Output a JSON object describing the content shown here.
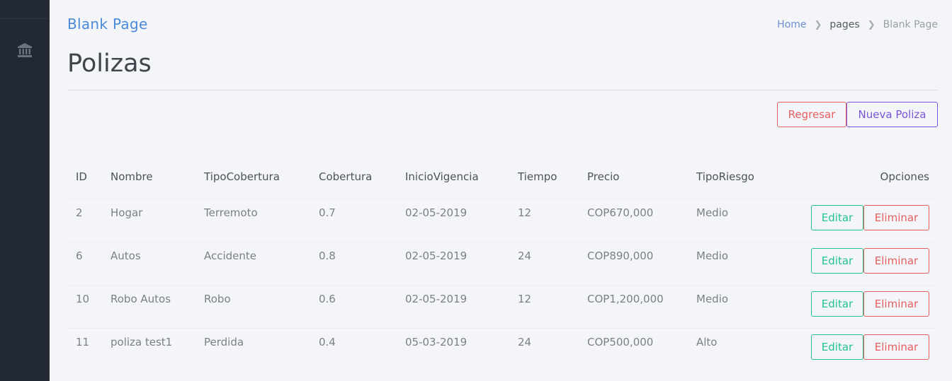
{
  "header": {
    "title": "Blank Page"
  },
  "breadcrumb": {
    "home": "Home",
    "pages": "pages",
    "current": "Blank Page"
  },
  "page": {
    "title": "Polizas"
  },
  "actions": {
    "back_label": "Regresar",
    "new_label": "Nueva Poliza"
  },
  "table": {
    "columns": [
      "ID",
      "Nombre",
      "TipoCobertura",
      "Cobertura",
      "InicioVigencia",
      "Tiempo",
      "Precio",
      "TipoRiesgo",
      "Opciones"
    ],
    "rows": [
      [
        "2",
        "Hogar",
        "Terremoto",
        "0.7",
        "02-05-2019",
        "12",
        "COP670,000",
        "Medio"
      ],
      [
        "6",
        "Autos",
        "Accidente",
        "0.8",
        "02-05-2019",
        "24",
        "COP890,000",
        "Medio"
      ],
      [
        "10",
        "Robo Autos",
        "Robo",
        "0.6",
        "02-05-2019",
        "12",
        "COP1,200,000",
        "Medio"
      ],
      [
        "11",
        "poliza test1",
        "Perdida",
        "0.4",
        "05-03-2019",
        "24",
        "COP500,000",
        "Alto"
      ]
    ],
    "edit_label": "Editar",
    "delete_label": "Eliminar"
  },
  "colors": {
    "accent_blue": "#4a8ad9",
    "danger": "#e55f5f",
    "primary": "#7a55d9",
    "success": "#22c38e",
    "sidebar": "#222933"
  },
  "icons": {
    "sidebar_nav": "bank-icon",
    "breadcrumb_separator": "chevron-right-icon"
  }
}
